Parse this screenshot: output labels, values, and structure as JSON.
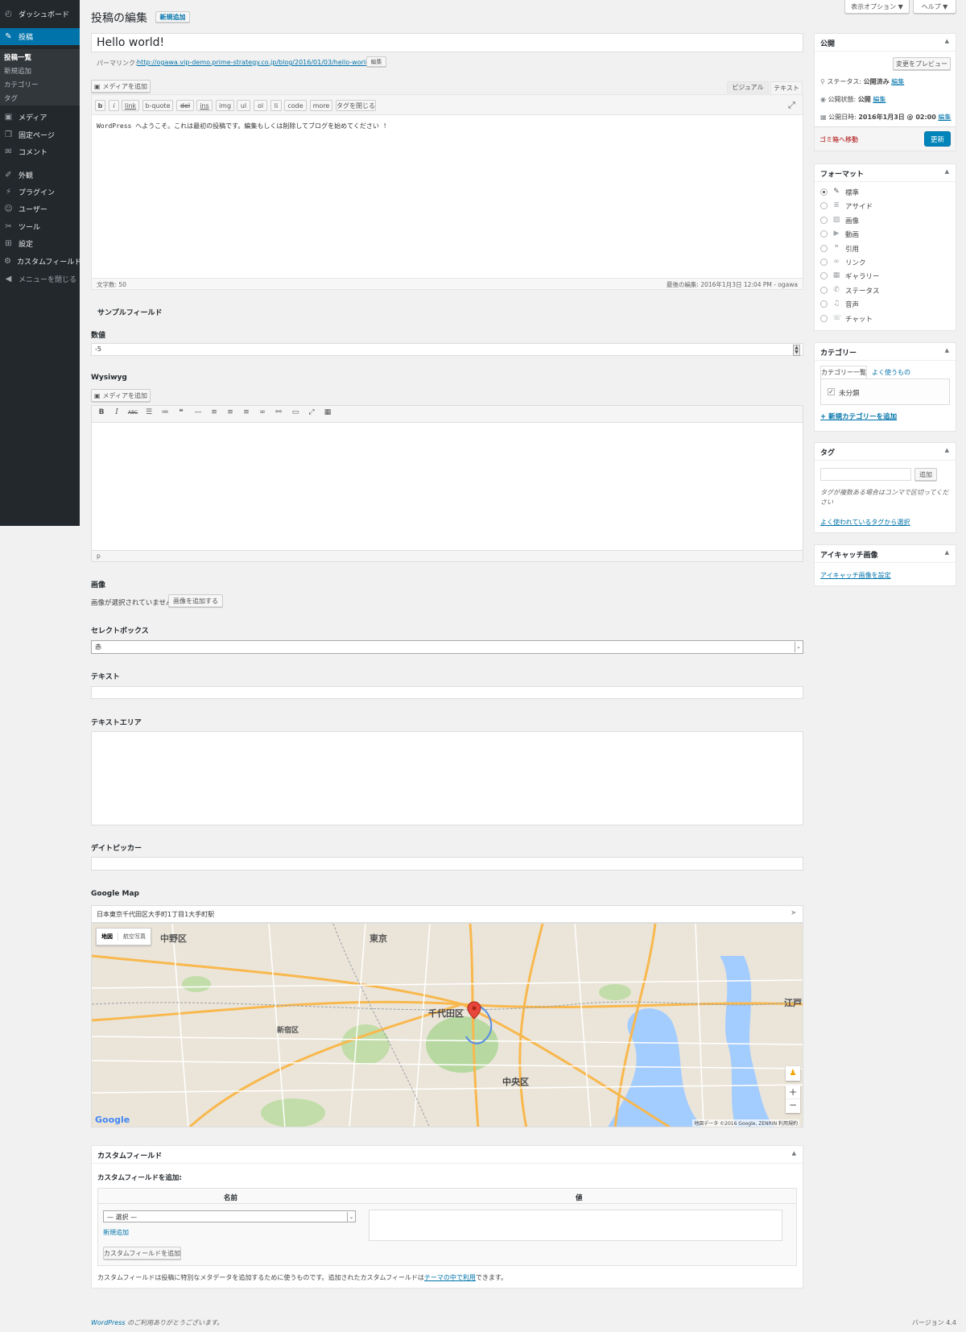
{
  "sidebar": {
    "items": [
      {
        "label": "ダッシュボード",
        "icon": "dashboard-icon",
        "glyph": "◴"
      },
      {
        "label": "投稿",
        "icon": "pin-icon",
        "glyph": "✎"
      },
      {
        "label": "メディア",
        "icon": "media-icon",
        "glyph": "▣"
      },
      {
        "label": "固定ページ",
        "icon": "pages-icon",
        "glyph": "❒"
      },
      {
        "label": "コメント",
        "icon": "comments-icon",
        "glyph": "✉"
      },
      {
        "label": "外観",
        "icon": "appearance-icon",
        "glyph": "✐"
      },
      {
        "label": "プラグイン",
        "icon": "plugins-icon",
        "glyph": "⚡"
      },
      {
        "label": "ユーザー",
        "icon": "users-icon",
        "glyph": "☺"
      },
      {
        "label": "ツール",
        "icon": "tools-icon",
        "glyph": "✂"
      },
      {
        "label": "設定",
        "icon": "settings-icon",
        "glyph": "⊞"
      },
      {
        "label": "カスタムフィールド",
        "icon": "gear-icon",
        "glyph": "⚙"
      },
      {
        "label": "メニューを閉じる",
        "icon": "collapse-icon",
        "glyph": "◀"
      }
    ],
    "submenu": [
      "投稿一覧",
      "新規追加",
      "カテゴリー",
      "タグ"
    ]
  },
  "screen_options": "表示オプション ▼",
  "help": "ヘルプ ▼",
  "page_title": "投稿の編集",
  "add_new": "新規追加",
  "post_title": "Hello world!",
  "permalink": {
    "label": "パーマリンク:",
    "url": "http://ogawa.vip-demo.prime-strategy.co.jp/blog/2016/01/03/hello-world/",
    "edit": "編集"
  },
  "add_media": "メディアを追加",
  "editor_tabs": {
    "visual": "ビジュアル",
    "text": "テキスト"
  },
  "quicktags": [
    "b",
    "i",
    "link",
    "b-quote",
    "del",
    "ins",
    "img",
    "ul",
    "ol",
    "li",
    "code",
    "more",
    "タグを閉じる"
  ],
  "content": "WordPress へようこそ。これは最初の投稿です。編集もしくは削除してブログを始めてください !",
  "word_count": "文字数: 50",
  "last_edited": "最後の編集: 2016年1月3日 12:04 PM - ogawa",
  "acf": {
    "title": "サンプルフィールド",
    "number_label": "数値",
    "number_value": "-5",
    "wysiwyg_label": "Wysiwyg",
    "wysiwyg_path": "p",
    "image_label": "画像",
    "image_none": "画像が選択されていません",
    "image_add": "画像を追加する",
    "select_label": "セレクトボックス",
    "select_value": "赤",
    "text_label": "テキスト",
    "textarea_label": "テキストエリア",
    "date_label": "デイトピッカー",
    "map_label": "Google Map",
    "map_address": "日本東京千代田区大手町1丁目1大手町駅"
  },
  "map": {
    "tab_map": "地図",
    "tab_satellite": "航空写真",
    "places": [
      "中野区",
      "東京",
      "千代田区",
      "中央区",
      "江戸",
      "新宿区"
    ],
    "logo": "Google",
    "attribution": "地図データ ©2016 Google, ZENRIN   利用規約"
  },
  "custom_fields": {
    "title": "カスタムフィールド",
    "add_label": "カスタムフィールドを追加:",
    "col_name": "名前",
    "col_value": "値",
    "select_placeholder": "— 選択 —",
    "new_link": "新規追加",
    "add_button": "カスタムフィールドを追加",
    "note_pre": "カスタムフィールドは投稿に特別なメタデータを追加するために使うものです。追加されたカスタムフィールドは",
    "note_link": "テーマの中で利用",
    "note_post": "できます。"
  },
  "footer": {
    "thanks": "WordPress のご利用ありがとうございます。",
    "version": "バージョン 4.4"
  },
  "publish": {
    "title": "公開",
    "preview": "変更をプレビュー",
    "status_label": "ステータス:",
    "status_value": "公開済み",
    "visibility_label": "公開状態:",
    "visibility_value": "公開",
    "date_label": "公開日時:",
    "date_value": "2016年1月3日 @ 02:00",
    "edit": "編集",
    "trash": "ゴミ箱へ移動",
    "update": "更新"
  },
  "format": {
    "title": "フォーマット",
    "options": [
      {
        "label": "標準",
        "icon": "pin-icon",
        "glyph": "✎"
      },
      {
        "label": "アサイド",
        "icon": "aside-icon",
        "glyph": "≣"
      },
      {
        "label": "画像",
        "icon": "image-icon",
        "glyph": "▨"
      },
      {
        "label": "動画",
        "icon": "video-icon",
        "glyph": "▶"
      },
      {
        "label": "引用",
        "icon": "quote-icon",
        "glyph": "❝"
      },
      {
        "label": "リンク",
        "icon": "link-icon",
        "glyph": "∞"
      },
      {
        "label": "ギャラリー",
        "icon": "gallery-icon",
        "glyph": "▦"
      },
      {
        "label": "ステータス",
        "icon": "status-icon",
        "glyph": "✆"
      },
      {
        "label": "音声",
        "icon": "audio-icon",
        "glyph": "♫"
      },
      {
        "label": "チャット",
        "icon": "chat-icon",
        "glyph": "☏"
      }
    ],
    "selected": 0
  },
  "category": {
    "title": "カテゴリー",
    "tab_all": "カテゴリー一覧",
    "tab_popular": "よく使うもの",
    "item": "未分類",
    "add_new": "+ 新規カテゴリーを追加"
  },
  "tags": {
    "title": "タグ",
    "add": "追加",
    "hint": "タグが複数ある場合はコンマで区切ってください",
    "choose": "よく使われているタグから選択"
  },
  "featured": {
    "title": "アイキャッチ画像",
    "set": "アイキャッチ画像を設定"
  },
  "colors": {
    "accent": "#0073aa",
    "sidebar": "#23282d",
    "trash": "#a00"
  }
}
